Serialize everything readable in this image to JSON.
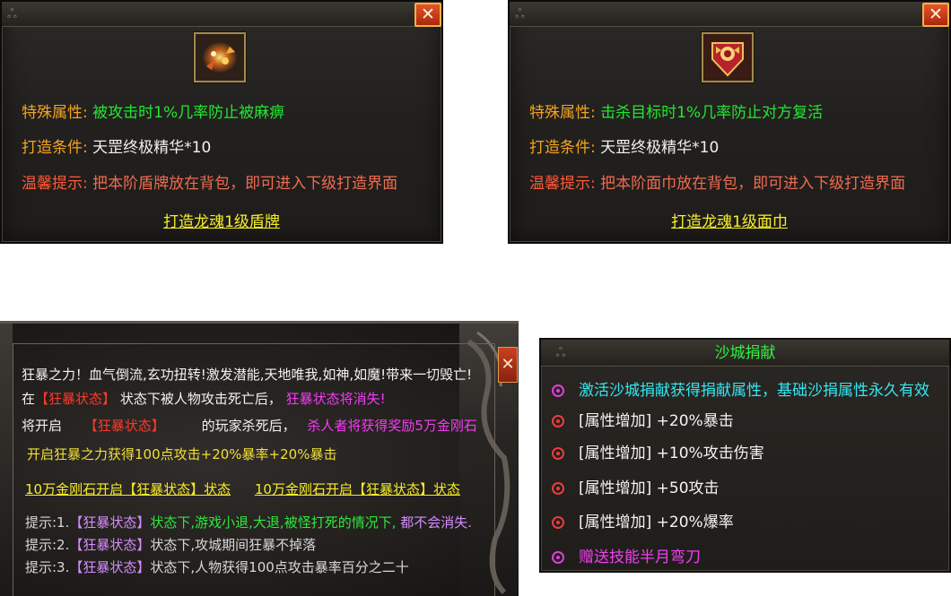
{
  "forge_left": {
    "close": "✕",
    "icon": "shield-item-icon",
    "special_label": "特殊属性:",
    "special_value": "被攻击时1%几率防止被麻痹",
    "condition_label": "打造条件:",
    "condition_value": "天罡终极精华*10",
    "tip_label": "温馨提示:",
    "tip_value": "把本阶盾牌放在背包，即可进入下级打造界面",
    "link": "打造龙魂1级盾牌"
  },
  "forge_right": {
    "close": "✕",
    "icon": "mask-item-icon",
    "special_label": "特殊属性:",
    "special_value": "击杀目标时1%几率防止对方复活",
    "condition_label": "打造条件:",
    "condition_value": "天罡终极精华*10",
    "tip_label": "温馨提示:",
    "tip_value": "把本阶面巾放在背包，即可进入下级打造界面",
    "link": "打造龙魂1级面巾"
  },
  "berserk": {
    "close": "✕",
    "line1": "狂暴之力！血气倒流,玄功扭转!激发潜能,天地唯我,如神,如魔!带来一切毁亡!",
    "line2_a": "在",
    "line2_b": "【狂暴状态】",
    "line2_c": "状态下被人物攻击死亡后，",
    "line2_d": "狂暴状态将消失!",
    "line3_a": "将开启",
    "line3_b": "【狂暴状态】",
    "line3_c": "的玩家杀死后，",
    "line3_d": "杀人者将获得奖励5万金刚石",
    "line4": "开启狂暴之力获得100点攻击+20%暴率+20%暴击",
    "link1": "10万金刚石开启【狂暴状态】状态",
    "link2": "10万金刚石开启【狂暴状态】状态",
    "tip1_a": "提示:1.",
    "tip1_b": "【狂暴状态】",
    "tip1_c": "状态下,游戏小退,大退,被怪打死的情况下,",
    "tip1_d": "都不会消失.",
    "tip2_a": "提示:2.",
    "tip2_b": "【狂暴状态】",
    "tip2_c": "状态下,攻城期间狂暴不掉落",
    "tip3_a": "提示:3.",
    "tip3_b": "【狂暴状态】",
    "tip3_c": "状态下,人物获得100点攻击暴率百分之二十"
  },
  "donation": {
    "title": "沙城捐献",
    "rows": [
      {
        "text": "激活沙城捐献获得捐献属性，基础沙捐属性永久有效"
      },
      {
        "text": "[属性增加] +20%暴击"
      },
      {
        "text": "[属性增加] +10%攻击伤害"
      },
      {
        "text": "[属性增加] +50攻击"
      },
      {
        "text": "[属性增加] +20%爆率"
      },
      {
        "text": "赠送技能半月弯刀"
      }
    ]
  }
}
